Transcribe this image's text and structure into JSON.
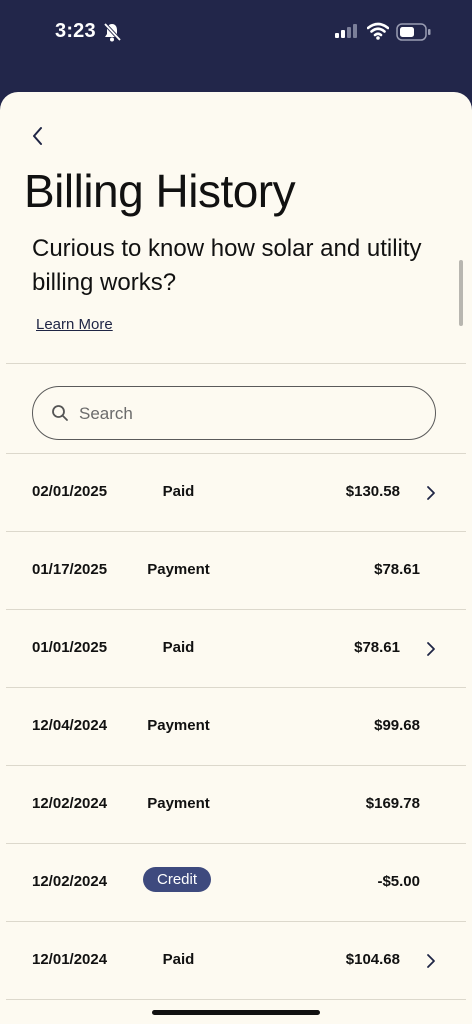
{
  "status_bar": {
    "time": "3:23"
  },
  "header": {
    "title": "Billing History",
    "subtitle": "Curious to know how solar and utility billing works?",
    "learn_more": "Learn More"
  },
  "search": {
    "placeholder": "Search",
    "value": ""
  },
  "transactions": [
    {
      "date": "02/01/2025",
      "type": "Paid",
      "amount": "$130.58",
      "badge": false,
      "chevron": true
    },
    {
      "date": "01/17/2025",
      "type": "Payment",
      "amount": "$78.61",
      "badge": false,
      "chevron": false
    },
    {
      "date": "01/01/2025",
      "type": "Paid",
      "amount": "$78.61",
      "badge": false,
      "chevron": true
    },
    {
      "date": "12/04/2024",
      "type": "Payment",
      "amount": "$99.68",
      "badge": false,
      "chevron": false
    },
    {
      "date": "12/02/2024",
      "type": "Payment",
      "amount": "$169.78",
      "badge": false,
      "chevron": false
    },
    {
      "date": "12/02/2024",
      "type": "Credit",
      "amount": "-$5.00",
      "badge": true,
      "chevron": false
    },
    {
      "date": "12/01/2024",
      "type": "Paid",
      "amount": "$104.68",
      "badge": false,
      "chevron": true
    }
  ],
  "colors": {
    "status_bg": "#22264a",
    "sheet_bg": "#fdfaf1",
    "badge_bg": "#3e4a7e"
  }
}
